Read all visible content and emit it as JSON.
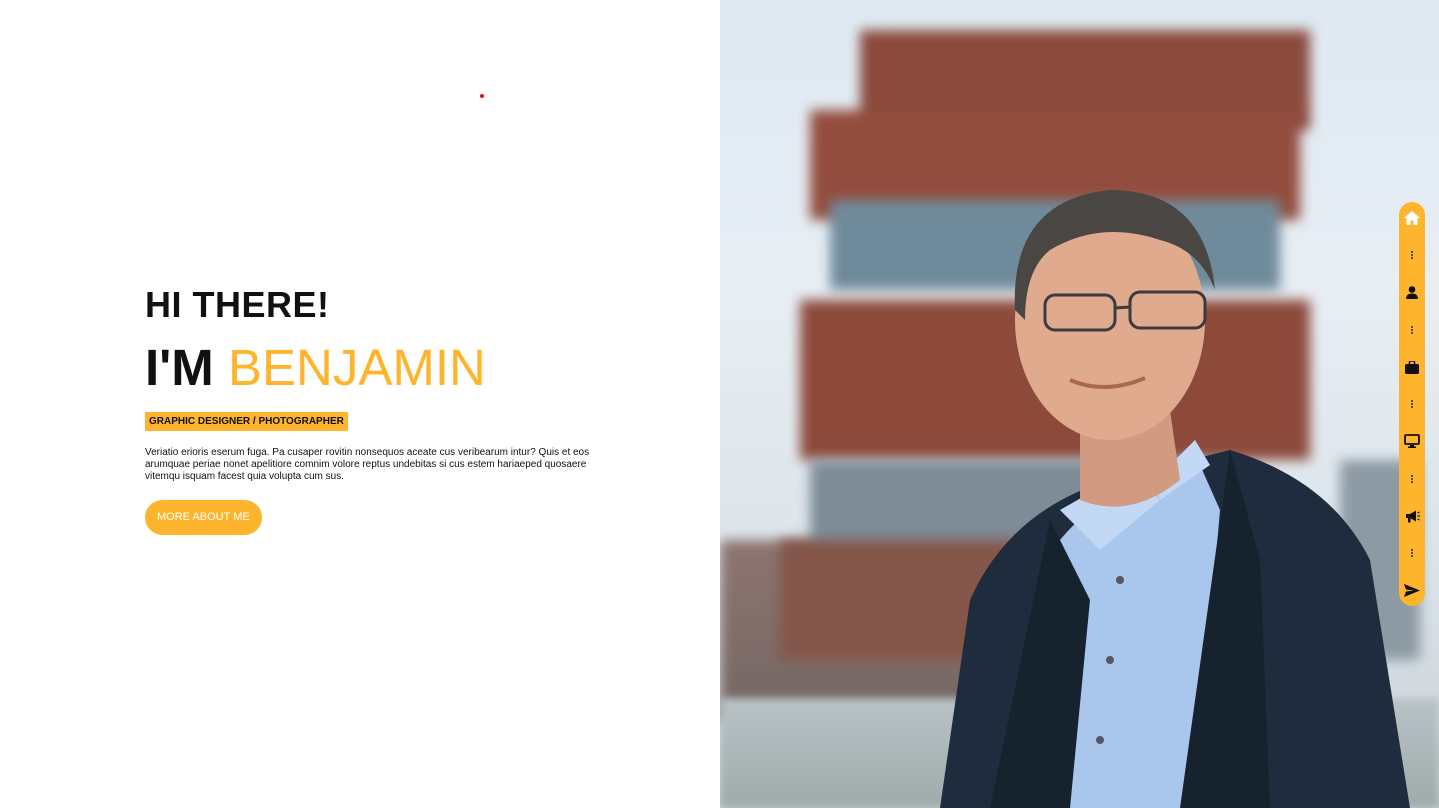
{
  "hero": {
    "greeting": "HI THERE!",
    "name_prefix": "I'M",
    "name": "BENJAMIN",
    "role": "GRAPHIC DESIGNER / PHOTOGRAPHER",
    "bio": "Veriatio erioris eserum fuga. Pa cusaper rovitin nonsequos aceate cus veribearum intur? Quis et eos arumquae periae nonet apelitiore comnim volore reptus undebitas si cus estem hariaeped quosaere vitemqu isquam facest quia volupta cum sus.",
    "cta_label": "MORE ABOUT ME"
  },
  "side_nav": {
    "items": [
      {
        "icon": "home-icon"
      },
      {
        "icon": "user-icon"
      },
      {
        "icon": "briefcase-icon"
      },
      {
        "icon": "monitor-icon"
      },
      {
        "icon": "megaphone-icon"
      },
      {
        "icon": "paper-plane-icon"
      }
    ]
  },
  "colors": {
    "accent": "#ffb42d",
    "text": "#111111",
    "background": "#ffffff"
  }
}
